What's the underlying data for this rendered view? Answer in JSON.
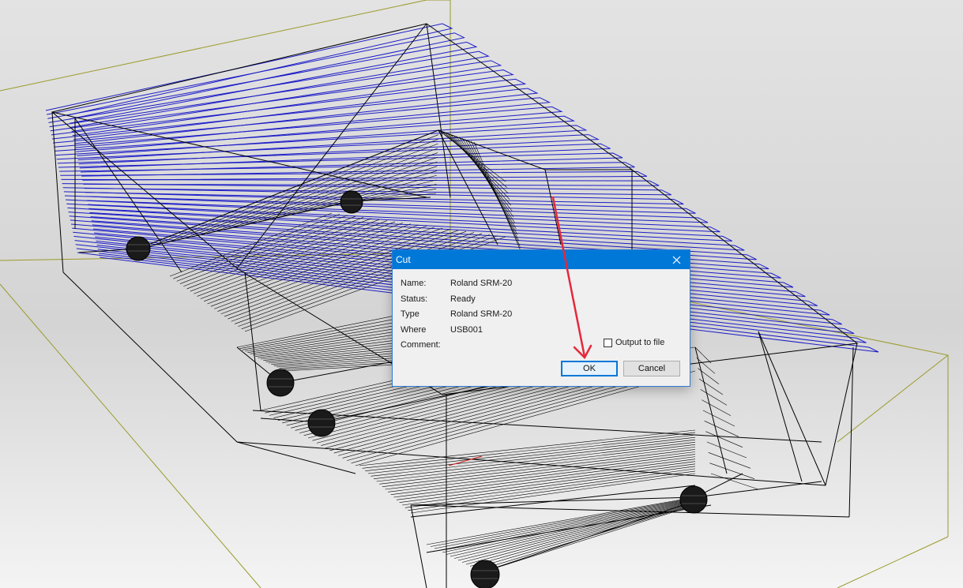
{
  "dialog": {
    "title": "Cut",
    "rows": [
      {
        "label": "Name:",
        "value": "Roland SRM-20"
      },
      {
        "label": "Status:",
        "value": "Ready"
      },
      {
        "label": "Type",
        "value": "Roland SRM-20"
      },
      {
        "label": "Where",
        "value": "USB001"
      },
      {
        "label": "Comment:",
        "value": ""
      }
    ],
    "output_to_file_label": "Output to file",
    "output_to_file_checked": false,
    "ok_label": "OK",
    "cancel_label": "Cancel"
  },
  "icons": {
    "close": "close-icon",
    "checkbox": "checkbox-icon",
    "annotation": "red-arrow-icon"
  },
  "colors": {
    "titlebar": "#0078d7",
    "toolpath": "#1c1cc8",
    "wireframe": "#000000",
    "stock_outline": "#9a9a2a",
    "annotation_arrow": "#e6283c"
  }
}
